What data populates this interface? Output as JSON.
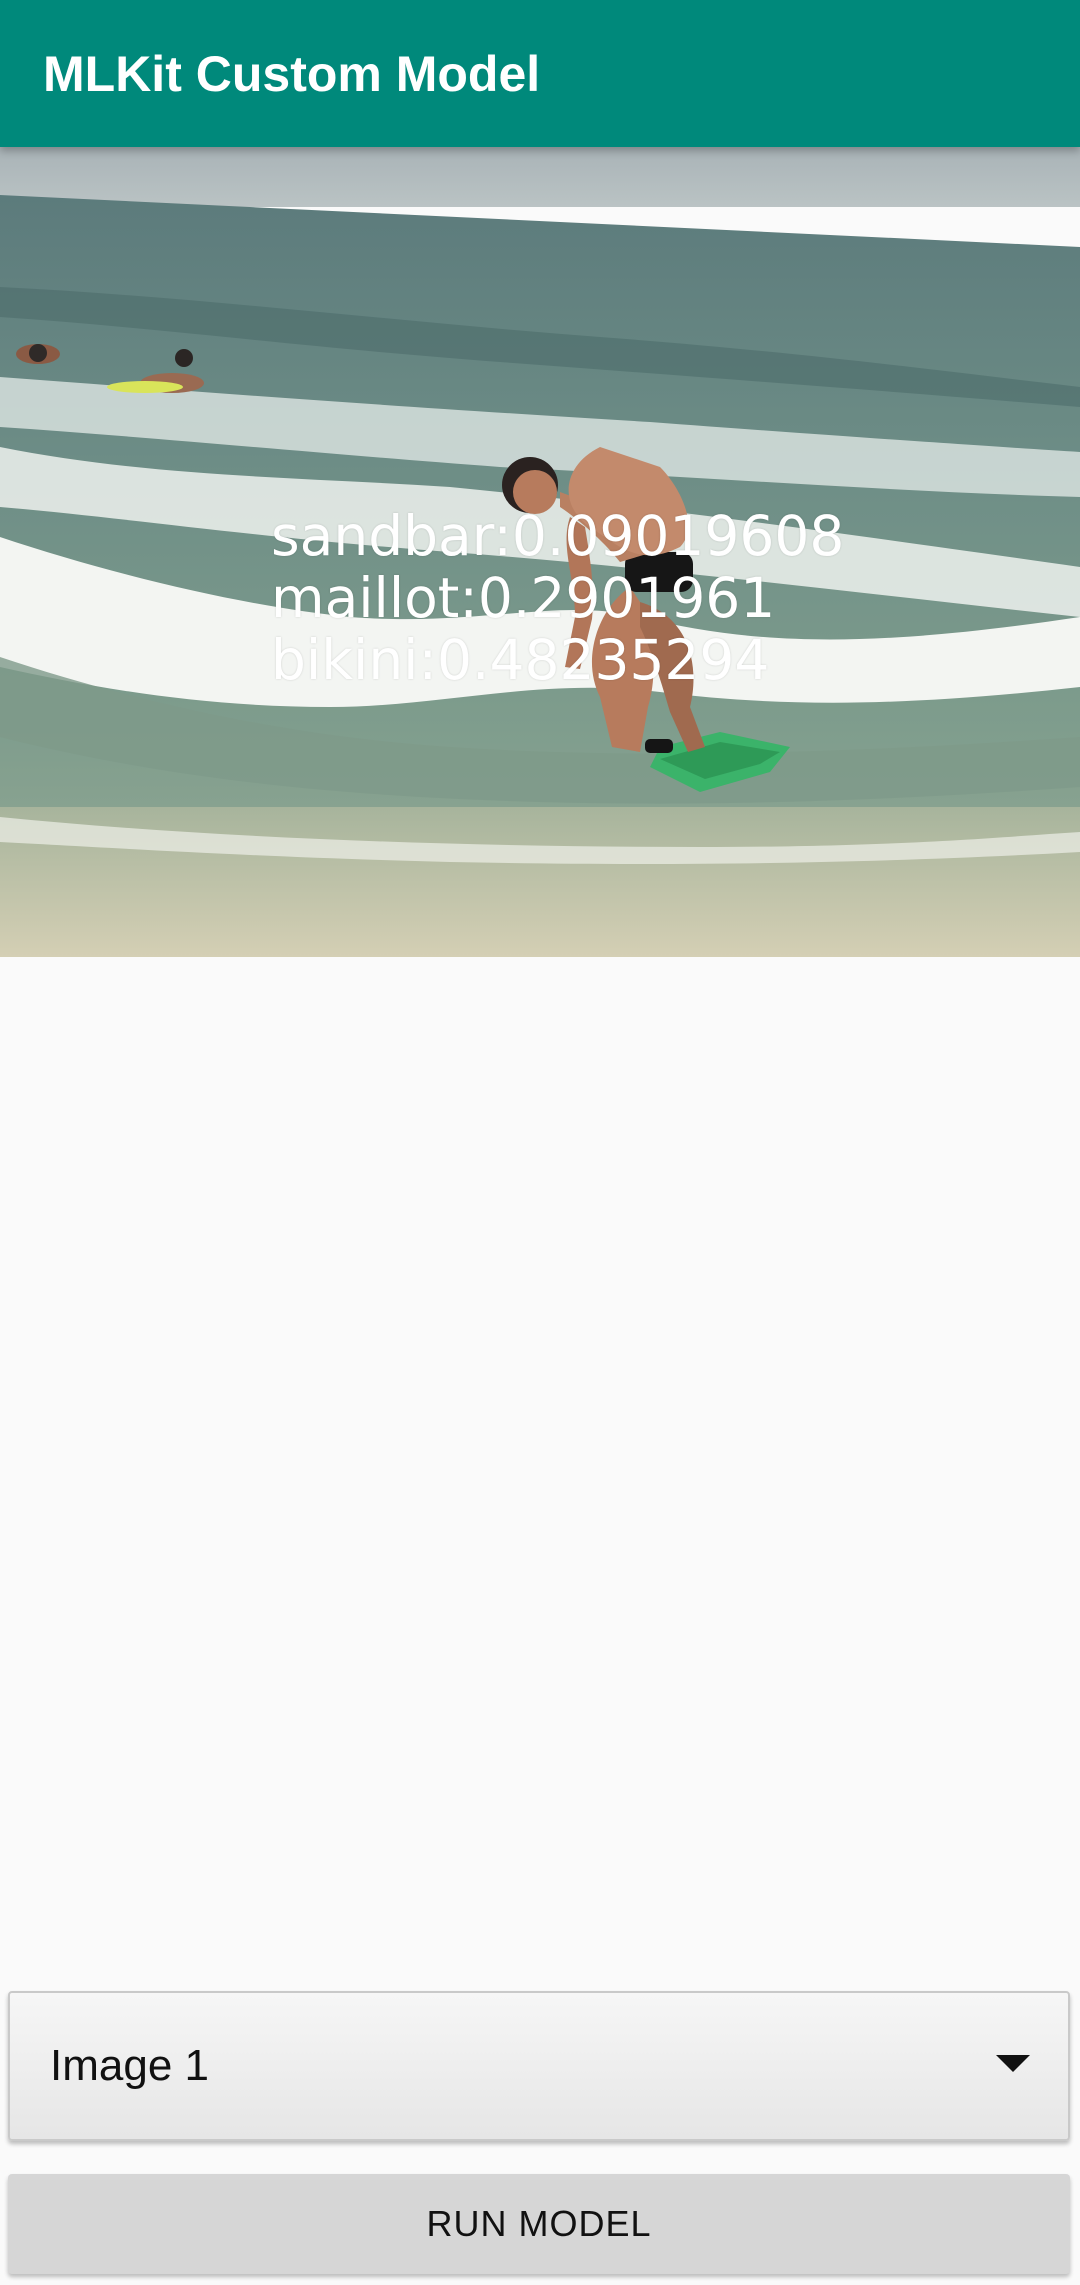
{
  "app_bar": {
    "title": "MLKit Custom Model",
    "color": "#00897b"
  },
  "image": {
    "description_icon": "beach-surfer-photo"
  },
  "results": [
    "sandbar:0.09019608",
    "maillot:0.2901961",
    "bikini:0.48235294"
  ],
  "spinner": {
    "selected": "Image 1"
  },
  "run_button": {
    "label": "RUN MODEL"
  }
}
